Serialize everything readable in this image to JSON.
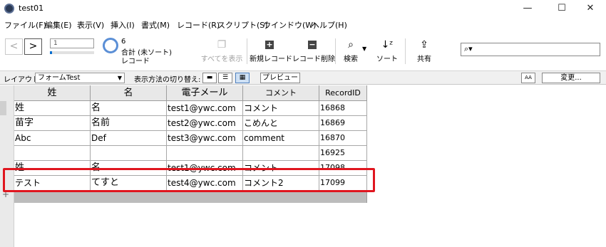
{
  "window": {
    "title": "test01"
  },
  "menu": [
    "ファイル(F)",
    "編集(E)",
    "表示(V)",
    "挿入(I)",
    "書式(M)",
    "レコード(R)",
    "スクリプト(S)",
    "ウインドウ(W)",
    "ヘルプ(H)"
  ],
  "toolbar": {
    "record_input": "1",
    "record_progress": 0.05,
    "record_count": "6",
    "record_summary": "合計 (未ソート)",
    "record_unit": "レコード",
    "showall_label": "すべてを表示",
    "newrec_label": "新規レコード",
    "delrec_label": "レコード削除",
    "find_label": "検索",
    "sort_label": "ソート",
    "share_label": "共有"
  },
  "layoutbar": {
    "layout_label": "レイアウト:",
    "layout_value": "フォームTest",
    "viewas_label": "表示方法の切り替え:",
    "preview_label": "プレビュー",
    "aa_label": "AA",
    "change_label": "変更..."
  },
  "table": {
    "columns": [
      "姓",
      "名",
      "電子メール",
      "コメント",
      "RecordID"
    ],
    "rows": [
      [
        "姓",
        "名",
        "test1@ywc.com",
        "コメント",
        "16868"
      ],
      [
        "苗字",
        "名前",
        "test2@ywc.com",
        "こめんと",
        "16869"
      ],
      [
        "Abc",
        "Def",
        "test3@ywc.com",
        "comment",
        "16870"
      ],
      [
        "",
        "",
        "",
        "",
        "16925"
      ],
      [
        "姓",
        "名",
        "test1@ywc.com",
        "コメント",
        "17098"
      ],
      [
        "テスト",
        "てすと",
        "test4@ywc.com",
        "コメント2",
        "17099"
      ]
    ]
  },
  "colors": {
    "highlight": "#e0161f",
    "accent": "#0b6fcf"
  }
}
